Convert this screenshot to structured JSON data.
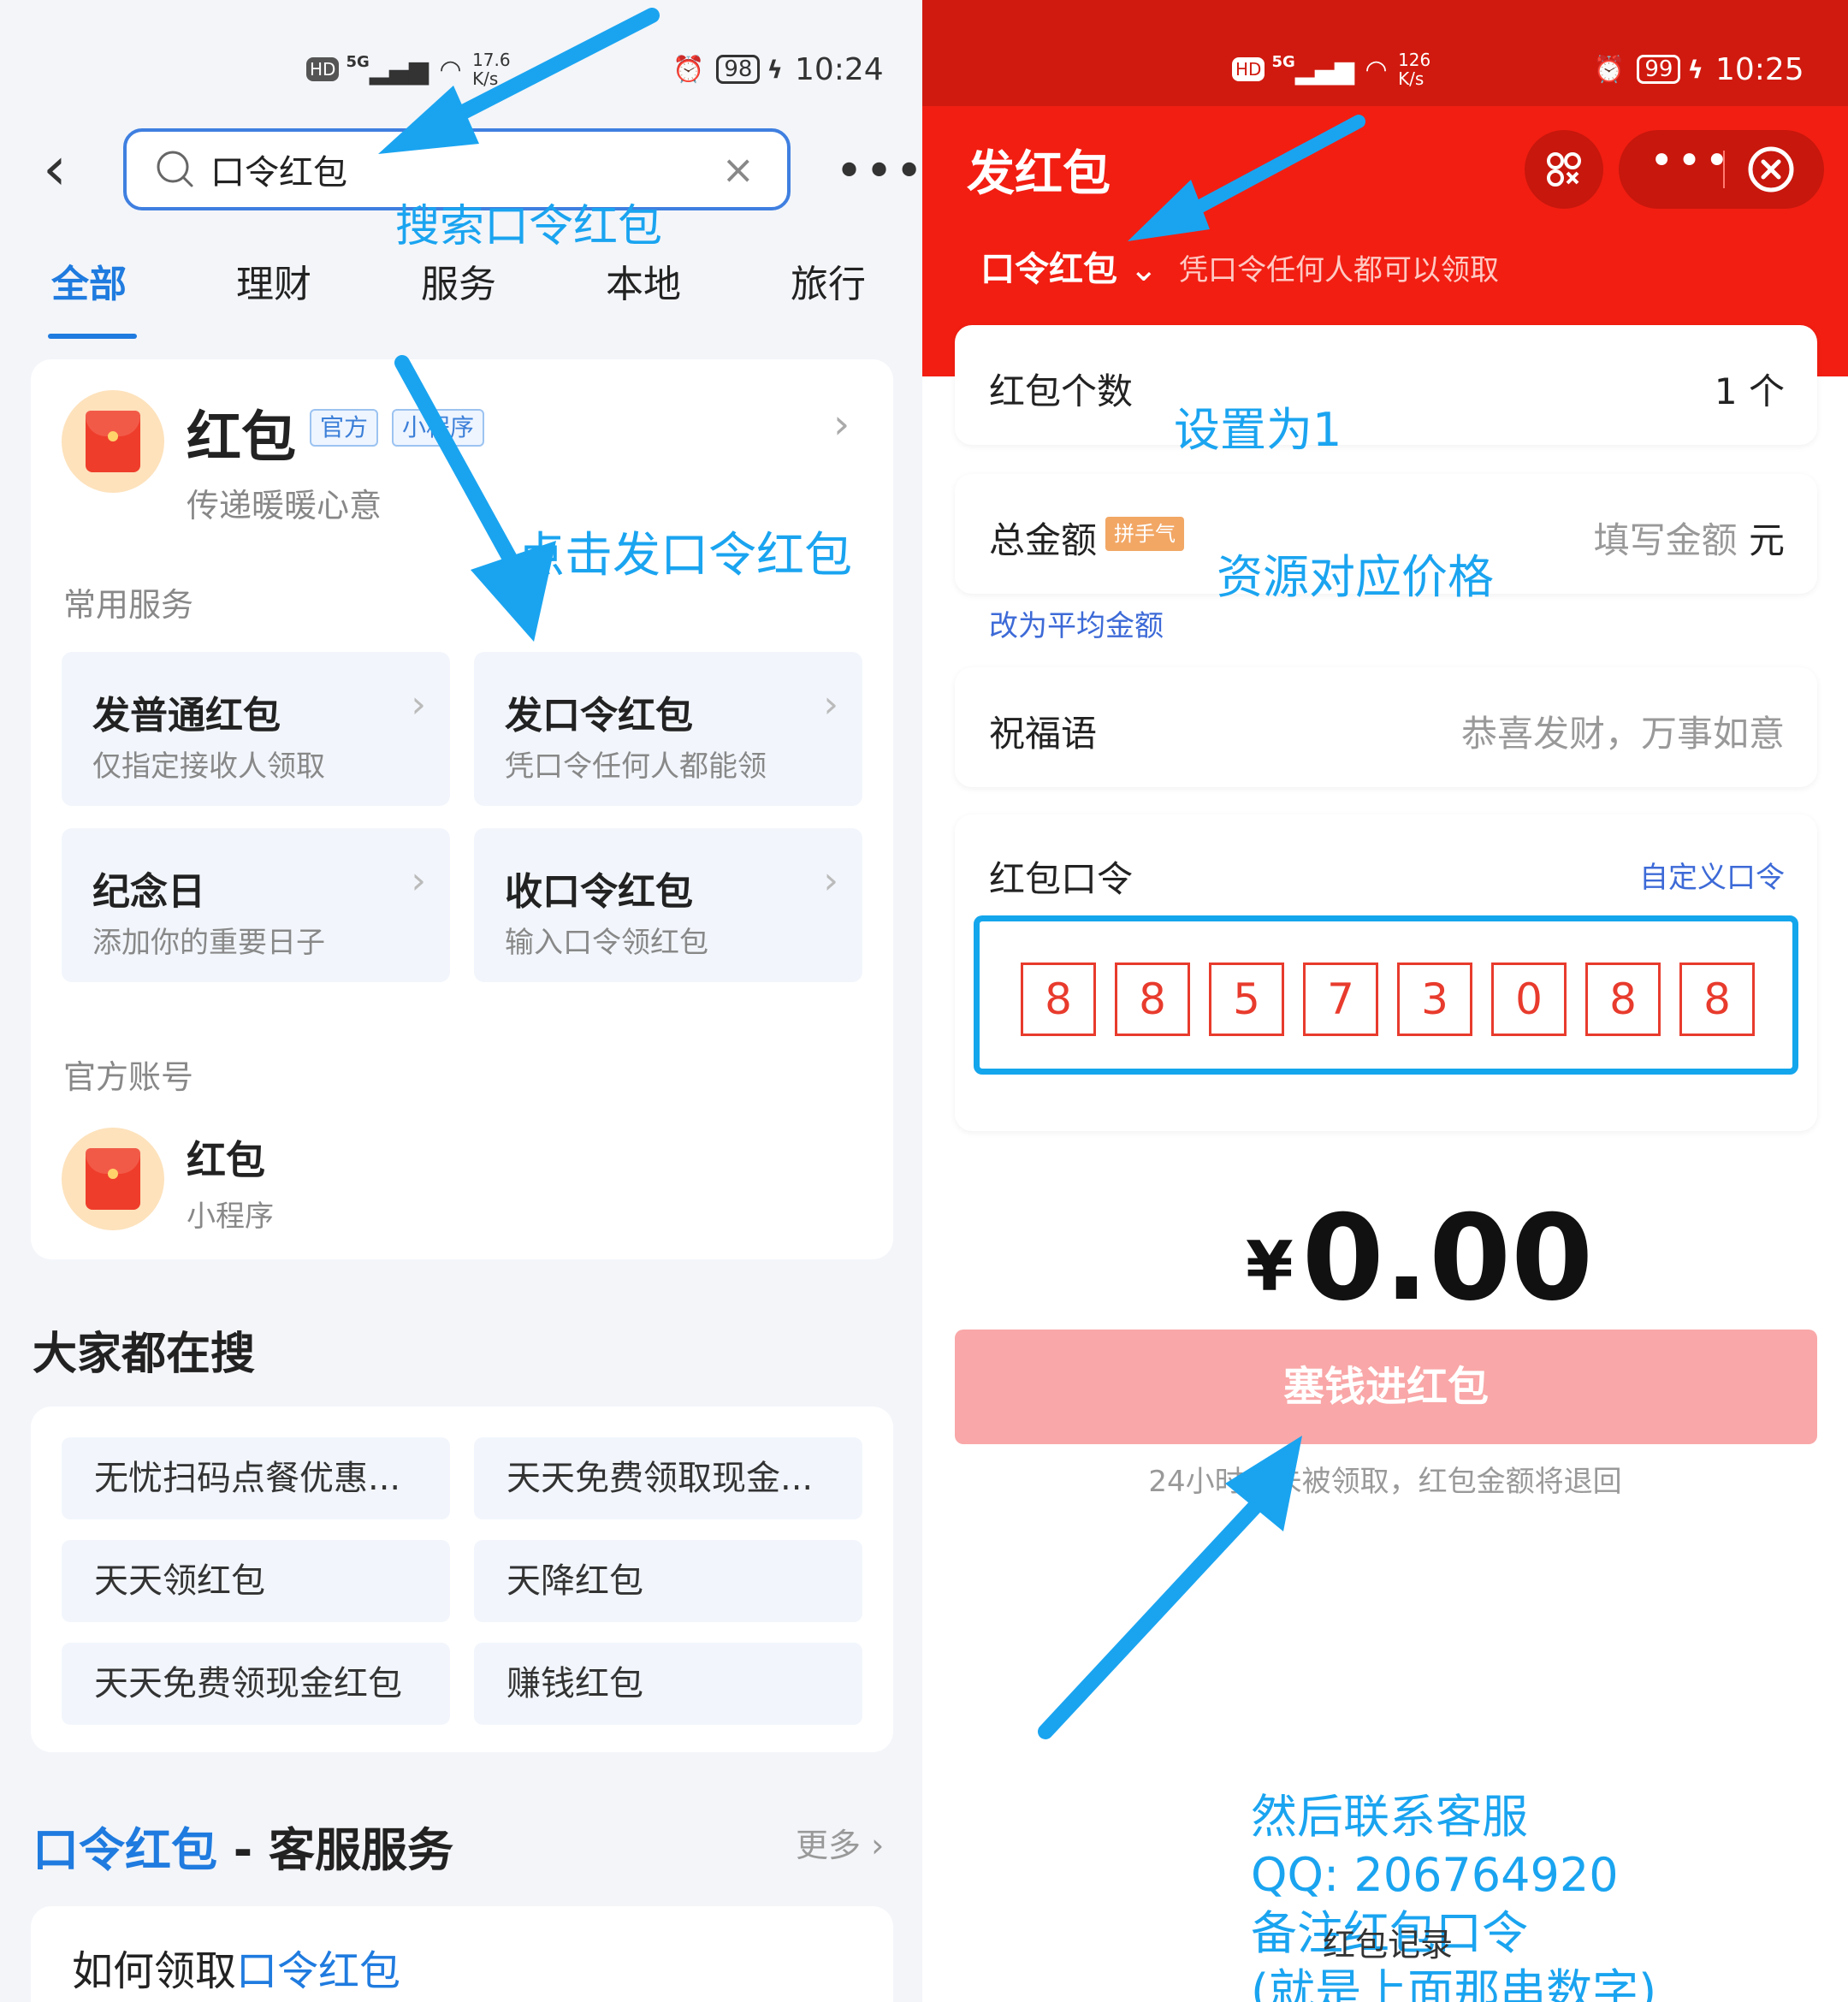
{
  "left": {
    "status": {
      "net_label": "HD",
      "net_type": "5G",
      "speed_value": "17.6",
      "speed_unit": "K/s",
      "battery": "98",
      "time": "10:24"
    },
    "search": {
      "query": "口令红包"
    },
    "annotations": {
      "search_hint": "搜索口令红包",
      "click_hint": "点击发口令红包"
    },
    "tabs": [
      "全部",
      "理财",
      "服务",
      "本地",
      "旅行"
    ],
    "app_card": {
      "name": "红包",
      "badge_official": "官方",
      "badge_mini": "小程序",
      "subtitle": "传递暖暖心意",
      "section_services": "常用服务",
      "services": [
        {
          "title": "发普通红包",
          "desc": "仅指定接收人领取"
        },
        {
          "title": "发口令红包",
          "desc": "凭口令任何人都能领"
        },
        {
          "title": "纪念日",
          "desc": "添加你的重要日子"
        },
        {
          "title": "收口令红包",
          "desc": "输入口令领红包"
        }
      ],
      "section_account": "官方账号",
      "account": {
        "name": "红包",
        "type": "小程序"
      }
    },
    "hot": {
      "title": "大家都在搜",
      "items": [
        "无忧扫码点餐优惠...",
        "天天免费领取现金...",
        "天天领红包",
        "天降红包",
        "天天免费领现金红包",
        "赚钱红包"
      ]
    },
    "cs": {
      "title_blue": "口令红包",
      "title_rest": " - 客服服务",
      "more": "更多",
      "q1_prefix": "如何领取",
      "q1_blue": "口令红包"
    }
  },
  "right": {
    "status": {
      "net_label": "HD",
      "net_type": "5G",
      "speed_value": "126",
      "speed_unit": "K/s",
      "battery": "99",
      "time": "10:25"
    },
    "title": "发红包",
    "type_label": "口令红包",
    "type_hint": "凭口令任何人都可以领取",
    "count": {
      "label": "红包个数",
      "value": "1",
      "unit": "个"
    },
    "total": {
      "label": "总金额",
      "tag": "拼手气",
      "placeholder": "填写金额",
      "unit": "元",
      "switch_link": "改为平均金额"
    },
    "blessing": {
      "label": "祝福语",
      "placeholder": "恭喜发财，万事如意"
    },
    "password": {
      "label": "红包口令",
      "custom_link": "自定义口令",
      "digits": [
        "8",
        "8",
        "5",
        "7",
        "3",
        "0",
        "8",
        "8"
      ]
    },
    "amount": {
      "currency": "¥",
      "value": "0.00"
    },
    "submit_label": "塞钱进红包",
    "refund_note": "24小时内未被领取，红包金额将退回",
    "annotations": {
      "count_hint": "设置为1",
      "price_hint": "资源对应价格",
      "contact_lines": [
        "然后联系客服",
        "QQ: 206764920",
        "备注红包口令",
        "(就是上面那串数字)"
      ],
      "overlap_text": "红包记录"
    }
  },
  "colors": {
    "accent_blue": "#1f7bdf",
    "annotation_blue": "#1aa4f0",
    "red": "#f21e12",
    "button_pink": "#f9a7a8"
  }
}
